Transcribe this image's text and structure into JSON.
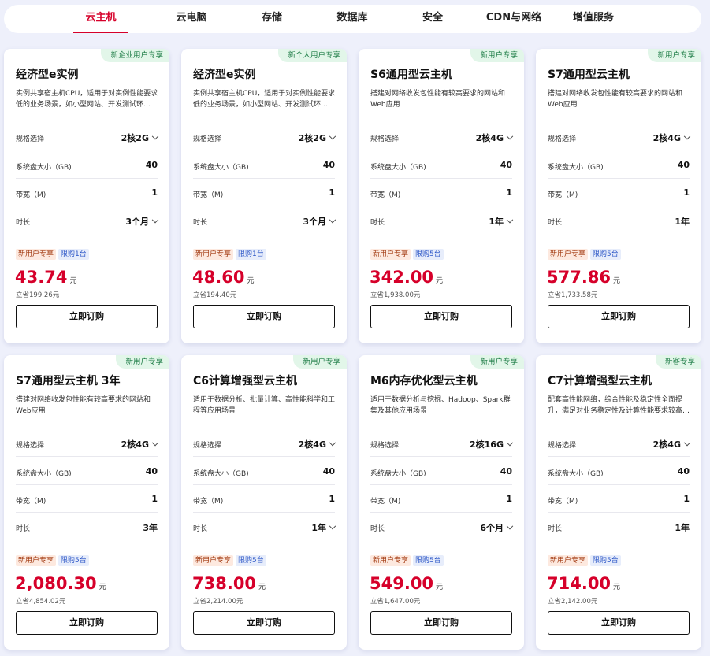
{
  "tabs": [
    {
      "label": "云主机",
      "active": true
    },
    {
      "label": "云电脑",
      "active": false
    },
    {
      "label": "存储",
      "active": false
    },
    {
      "label": "数据库",
      "active": false
    },
    {
      "label": "安全",
      "active": false
    },
    {
      "label": "CDN与网络",
      "active": false
    },
    {
      "label": "增值服务",
      "active": false
    }
  ],
  "labels": {
    "spec": "规格选择",
    "disk": "系统盘大小（GB)",
    "bandwidth": "带宽（M)",
    "duration": "时长",
    "buy": "立即订购",
    "unit": "元"
  },
  "cards": [
    {
      "corner": "新企业用户专享",
      "title": "经济型e实例",
      "desc": "实例共享宿主机CPU，适用于对实例性能要求低的业务场景，如小型网站、开发测试环…",
      "spec": "2核2G",
      "spec_dropdown": true,
      "disk": "40",
      "bandwidth": "1",
      "duration": "3个月",
      "duration_dropdown": true,
      "badge_new": "新用户专享",
      "badge_limit": "限购1台",
      "price": "43.74",
      "save": "立省199.26元"
    },
    {
      "corner": "新个人用户专享",
      "title": "经济型e实例",
      "desc": "实例共享宿主机CPU，适用于对实例性能要求低的业务场景，如小型网站、开发测试环…",
      "spec": "2核2G",
      "spec_dropdown": true,
      "disk": "40",
      "bandwidth": "1",
      "duration": "3个月",
      "duration_dropdown": true,
      "badge_new": "新用户专享",
      "badge_limit": "限购1台",
      "price": "48.60",
      "save": "立省194.40元"
    },
    {
      "corner": "新用户专享",
      "title": "S6通用型云主机",
      "desc": "搭建对网络收发包性能有较高要求的网站和Web应用",
      "spec": "2核4G",
      "spec_dropdown": true,
      "disk": "40",
      "bandwidth": "1",
      "duration": "1年",
      "duration_dropdown": true,
      "badge_new": "新用户专享",
      "badge_limit": "限购5台",
      "price": "342.00",
      "save": "立省1,938.00元"
    },
    {
      "corner": "新用户专享",
      "title": "S7通用型云主机",
      "desc": "搭建对网络收发包性能有较高要求的网站和Web应用",
      "spec": "2核4G",
      "spec_dropdown": true,
      "disk": "40",
      "bandwidth": "1",
      "duration": "1年",
      "duration_dropdown": false,
      "badge_new": "新用户专享",
      "badge_limit": "限购5台",
      "price": "577.86",
      "save": "立省1,733.58元"
    },
    {
      "corner": "新用户专享",
      "title": "S7通用型云主机 3年",
      "desc": "搭建对网络收发包性能有较高要求的网站和Web应用",
      "spec": "2核4G",
      "spec_dropdown": true,
      "disk": "40",
      "bandwidth": "1",
      "duration": "3年",
      "duration_dropdown": false,
      "badge_new": "新用户专享",
      "badge_limit": "限购5台",
      "price": "2,080.30",
      "save": "立省4,854.02元"
    },
    {
      "corner": "新用户专享",
      "title": "C6计算增强型云主机",
      "desc": "适用于数据分析、批量计算、高性能科学和工程等应用场景",
      "spec": "2核4G",
      "spec_dropdown": true,
      "disk": "40",
      "bandwidth": "1",
      "duration": "1年",
      "duration_dropdown": true,
      "badge_new": "新用户专享",
      "badge_limit": "限购5台",
      "price": "738.00",
      "save": "立省2,214.00元"
    },
    {
      "corner": "新用户专享",
      "title": "M6内存优化型云主机",
      "desc": "适用于数据分析与挖掘、Hadoop、Spark群集及其他应用场景",
      "spec": "2核16G",
      "spec_dropdown": true,
      "disk": "40",
      "bandwidth": "1",
      "duration": "6个月",
      "duration_dropdown": true,
      "badge_new": "新用户专享",
      "badge_limit": "限购5台",
      "price": "549.00",
      "save": "立省1,647.00元"
    },
    {
      "corner": "新客专享",
      "title": "C7计算增强型云主机",
      "desc": "配套高性能网络，综合性能及稳定性全面提升，满足对业务稳定性及计算性能要求较高…",
      "spec": "2核4G",
      "spec_dropdown": true,
      "disk": "40",
      "bandwidth": "1",
      "duration": "1年",
      "duration_dropdown": false,
      "badge_new": "新用户专享",
      "badge_limit": "限购5台",
      "price": "714.00",
      "save": "立省2,142.00元"
    }
  ]
}
